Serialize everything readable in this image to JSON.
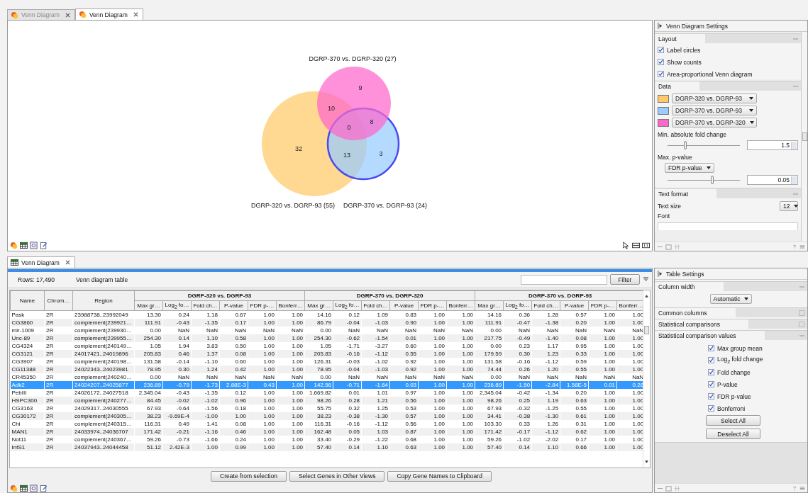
{
  "tabs": [
    {
      "label": "Venn Diagram",
      "selected": false
    },
    {
      "label": "Venn Diagram",
      "selected": true
    }
  ],
  "venn": {
    "sets": [
      {
        "label": "DGRP-320 vs. DGRP-93 (55)",
        "selected": false
      },
      {
        "label": "DGRP-370 vs. DGRP-93 (24)",
        "selected": true
      },
      {
        "label": "DGRP-370 vs. DGRP-320 (27)",
        "selected": false
      }
    ],
    "counts": [
      "9",
      "10",
      "0",
      "8",
      "32",
      "13",
      "3"
    ]
  },
  "venn_settings": {
    "title": "Venn Diagram Settings",
    "layout": {
      "title": "Layout",
      "expanded": true,
      "options": [
        {
          "label": "Label circles",
          "checked": true
        },
        {
          "label": "Show counts",
          "checked": true
        },
        {
          "label": "Area-proportional Venn diagram",
          "checked": true
        }
      ]
    },
    "data": {
      "title": "Data",
      "expanded": true,
      "series": [
        {
          "color": "#ffc966",
          "value": "DGRP-320 vs. DGRP-93"
        },
        {
          "color": "#99ccff",
          "value": "DGRP-370 vs. DGRP-93"
        },
        {
          "color": "#ff66cc",
          "value": "DGRP-370 vs. DGRP-320"
        }
      ],
      "fold_change": {
        "label": "Min. absolute fold change",
        "level": 0.25,
        "value": "1.5"
      },
      "p_value": {
        "label": "Max. p-value",
        "mode": "FDR p-value",
        "level": 0.62,
        "value": "0.05"
      }
    },
    "text_format": {
      "title": "Text format",
      "expanded": true,
      "size_label": "Text size",
      "size": "12",
      "font_label": "Font"
    }
  },
  "table_tab": {
    "label": "Venn Diagram"
  },
  "table_info": {
    "rows": "Rows: 17,490",
    "title": "Venn diagram table",
    "filter_button": "Filter"
  },
  "table": {
    "fixed_columns": [
      "Name",
      "Chrom…",
      "Region"
    ],
    "groups": [
      {
        "title": "DGRP-320 vs. DGRP-93",
        "columns": [
          "Max gr…",
          "Log$_{2}$ fo…",
          "Fold ch…",
          "P-value",
          "FDR p-…",
          "Bonferr…"
        ]
      },
      {
        "title": "DGRP-370 vs. DGRP-320",
        "columns": [
          "Max gr…",
          "Log$_{2}$ fo…",
          "Fold ch…",
          "P-value",
          "FDR p-…",
          "Bonferr…"
        ]
      },
      {
        "title": "DGRP-370 vs. DGRP-93",
        "columns": [
          "Max gr…",
          "Log$_{2}$ fo…",
          "Fold ch…",
          "P-value",
          "FDR p-…",
          "Bonferr…"
        ]
      }
    ],
    "rows": [
      {
        "selected": false,
        "cells": [
          "Pask",
          "2R",
          "23988738..23992049",
          "13.30",
          "0.24",
          "1.18",
          "0.67",
          "1.00",
          "1.00",
          "14.16",
          "0.12",
          "1.09",
          "0.83",
          "1.00",
          "1.00",
          "14.16",
          "0.36",
          "1.28",
          "0.57",
          "1.00",
          "1.00"
        ]
      },
      {
        "selected": false,
        "cells": [
          "CG3860",
          "2R",
          "complement(239921…",
          "111.91",
          "-0.43",
          "-1.35",
          "0.17",
          "1.00",
          "1.00",
          "86.79",
          "-0.04",
          "-1.03",
          "0.90",
          "1.00",
          "1.00",
          "111.91",
          "-0.47",
          "-1.38",
          "0.20",
          "1.00",
          "1.00"
        ]
      },
      {
        "selected": false,
        "cells": [
          "mir-1009",
          "2R",
          "complement(239930…",
          "0.00",
          "NaN",
          "NaN",
          "NaN",
          "NaN",
          "NaN",
          "0.00",
          "NaN",
          "NaN",
          "NaN",
          "NaN",
          "NaN",
          "0.00",
          "NaN",
          "NaN",
          "NaN",
          "NaN",
          "NaN"
        ]
      },
      {
        "selected": false,
        "cells": [
          "Unc-89",
          "2R",
          "complement(239955…",
          "254.30",
          "0.14",
          "1.10",
          "0.58",
          "1.00",
          "1.00",
          "254.30",
          "-0.62",
          "-1.54",
          "0.01",
          "1.00",
          "1.00",
          "217.75",
          "-0.49",
          "-1.40",
          "0.08",
          "1.00",
          "1.00"
        ]
      },
      {
        "selected": false,
        "cells": [
          "CG4324",
          "2R",
          "complement(240149…",
          "1.05",
          "1.94",
          "3.83",
          "0.50",
          "1.00",
          "1.00",
          "1.05",
          "-1.71",
          "-3.27",
          "0.60",
          "1.00",
          "1.00",
          "0.00",
          "0.23",
          "1.17",
          "0.95",
          "1.00",
          "1.00"
        ]
      },
      {
        "selected": false,
        "cells": [
          "CG3121",
          "2R",
          "24017421..24019896",
          "205.83",
          "0.46",
          "1.37",
          "0.08",
          "1.00",
          "1.00",
          "205.83",
          "-0.16",
          "-1.12",
          "0.55",
          "1.00",
          "1.00",
          "179.59",
          "0.30",
          "1.23",
          "0.33",
          "1.00",
          "1.00"
        ]
      },
      {
        "selected": false,
        "cells": [
          "CG3907",
          "2R",
          "complement(240198…",
          "131.58",
          "-0.14",
          "-1.10",
          "0.60",
          "1.00",
          "1.00",
          "126.31",
          "-0.03",
          "-1.02",
          "0.92",
          "1.00",
          "1.00",
          "131.58",
          "-0.16",
          "-1.12",
          "0.59",
          "1.00",
          "1.00"
        ]
      },
      {
        "selected": false,
        "cells": [
          "CG11388",
          "2R",
          "24022343..24023981",
          "78.95",
          "0.30",
          "1.24",
          "0.42",
          "1.00",
          "1.00",
          "78.95",
          "-0.04",
          "-1.03",
          "0.92",
          "1.00",
          "1.00",
          "74.44",
          "0.26",
          "1.20",
          "0.55",
          "1.00",
          "1.00"
        ]
      },
      {
        "selected": false,
        "cells": [
          "CR45350",
          "2R",
          "complement(240240…",
          "0.00",
          "NaN",
          "NaN",
          "NaN",
          "NaN",
          "NaN",
          "0.00",
          "NaN",
          "NaN",
          "NaN",
          "NaN",
          "NaN",
          "0.00",
          "NaN",
          "NaN",
          "NaN",
          "NaN",
          "NaN"
        ]
      },
      {
        "selected": true,
        "cells": [
          "Adk2",
          "2R",
          "24024207..24025877",
          "236.89",
          "-0.79",
          "-1.73",
          "2.88E-3",
          "0.43",
          "1.00",
          "142.56",
          "-0.71",
          "-1.64",
          "0.03",
          "1.00",
          "1.00",
          "236.89",
          "-1.50",
          "-2.84",
          "1.58E-5",
          "0.01",
          "0.28"
        ]
      },
      {
        "selected": false,
        "cells": [
          "PebIII",
          "2R",
          "24026172..24027518",
          "2,345.04",
          "-0.43",
          "-1.35",
          "0.12",
          "1.00",
          "1.00",
          "1,669.82",
          "0.01",
          "1.01",
          "0.97",
          "1.00",
          "1.00",
          "2,345.04",
          "-0.42",
          "-1.34",
          "0.20",
          "1.00",
          "1.00"
        ]
      },
      {
        "selected": false,
        "cells": [
          "HSPC300",
          "2R",
          "complement(240277…",
          "84.45",
          "-0.02",
          "-1.02",
          "0.96",
          "1.00",
          "1.00",
          "98.26",
          "0.28",
          "1.21",
          "0.56",
          "1.00",
          "1.00",
          "98.26",
          "0.25",
          "1.19",
          "0.63",
          "1.00",
          "1.00"
        ]
      },
      {
        "selected": false,
        "cells": [
          "CG3163",
          "2R",
          "24029317..24030555",
          "67.93",
          "-0.64",
          "-1.56",
          "0.18",
          "1.00",
          "1.00",
          "55.75",
          "0.32",
          "1.25",
          "0.53",
          "1.00",
          "1.00",
          "67.93",
          "-0.32",
          "-1.25",
          "0.55",
          "1.00",
          "1.00"
        ]
      },
      {
        "selected": false,
        "cells": [
          "CG30172",
          "2R",
          "complement(240305…",
          "38.23",
          "-9.69E-4",
          "-1.00",
          "1.00",
          "1.00",
          "1.00",
          "38.23",
          "-0.38",
          "-1.30",
          "0.57",
          "1.00",
          "1.00",
          "34.41",
          "-0.38",
          "-1.30",
          "0.61",
          "1.00",
          "1.00"
        ]
      },
      {
        "selected": false,
        "cells": [
          "Chi",
          "2R",
          "complement(240315…",
          "116.31",
          "0.49",
          "1.41",
          "0.08",
          "1.00",
          "1.00",
          "116.31",
          "-0.16",
          "-1.12",
          "0.56",
          "1.00",
          "1.00",
          "103.30",
          "0.33",
          "1.26",
          "0.31",
          "1.00",
          "1.00"
        ]
      },
      {
        "selected": false,
        "cells": [
          "MAN1",
          "2R",
          "24033974..24036707",
          "171.42",
          "-0.21",
          "-1.16",
          "0.46",
          "1.00",
          "1.00",
          "162.48",
          "0.05",
          "1.03",
          "0.87",
          "1.00",
          "1.00",
          "171.42",
          "-0.17",
          "-1.12",
          "0.62",
          "1.00",
          "1.00"
        ]
      },
      {
        "selected": false,
        "cells": [
          "Not11",
          "2R",
          "complement(240367…",
          "59.26",
          "-0.73",
          "-1.66",
          "0.24",
          "1.00",
          "1.00",
          "33.40",
          "-0.29",
          "-1.22",
          "0.68",
          "1.00",
          "1.00",
          "59.26",
          "-1.02",
          "-2.02",
          "0.17",
          "1.00",
          "1.00"
        ]
      },
      {
        "selected": false,
        "cells": [
          "IntS1",
          "2R",
          "24037943..24044458",
          "51.12",
          "2.42E-3",
          "1.00",
          "0.99",
          "1.00",
          "1.00",
          "57.40",
          "0.14",
          "1.10",
          "0.63",
          "1.00",
          "1.00",
          "57.40",
          "0.14",
          "1.10",
          "0.66",
          "1.00",
          "1.00"
        ]
      }
    ]
  },
  "table_buttons": [
    "Create from selection",
    "Select Genes in Other Views",
    "Copy Gene Names to Clipboard"
  ],
  "table_settings": {
    "title": "Table Settings",
    "sections": [
      {
        "title": "Column width",
        "expanded": true
      },
      {
        "title": "Common columns",
        "expanded": false
      },
      {
        "title": "Statistical comparisons",
        "expanded": false
      },
      {
        "title": "Statistical comparison values",
        "expanded": true
      }
    ],
    "column_width": "Automatic",
    "values": [
      {
        "label": "Max group mean",
        "checked": true
      },
      {
        "label": "Log$_{2}$ fold change",
        "checked": true
      },
      {
        "label": "Fold change",
        "checked": true
      },
      {
        "label": "P-value",
        "checked": true
      },
      {
        "label": "FDR p-value",
        "checked": true
      },
      {
        "label": "Bonferroni",
        "checked": true
      }
    ],
    "select_all": "Select All",
    "deselect_all": "Deselect All"
  }
}
